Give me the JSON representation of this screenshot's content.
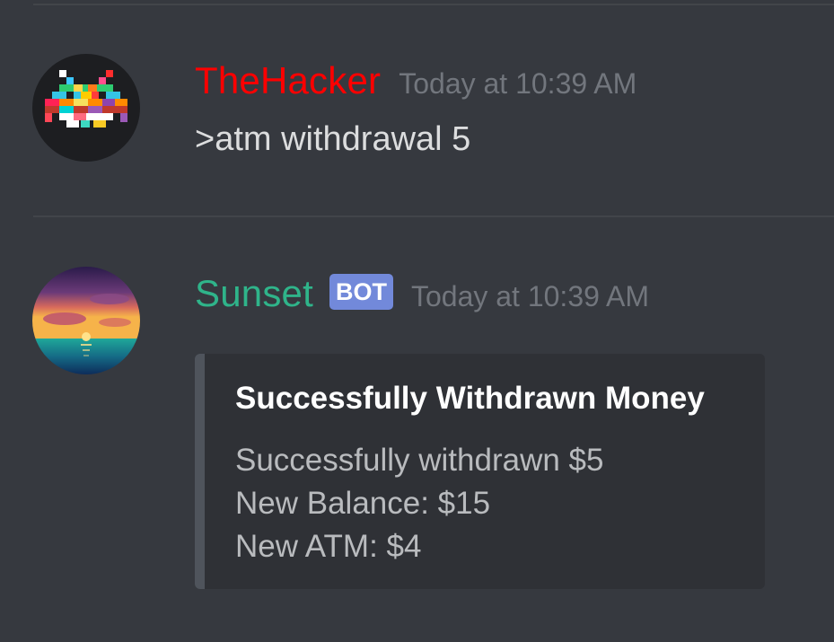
{
  "messages": [
    {
      "author": "TheHacker",
      "author_color": "#ff0000",
      "timestamp": "Today at 10:39 AM",
      "content": ">atm withdrawal 5",
      "avatar_icon": "space-invader-avatar"
    },
    {
      "author": "Sunset",
      "author_color": "#2fb48a",
      "badge": "BOT",
      "timestamp": "Today at 10:39 AM",
      "avatar_icon": "sunset-avatar",
      "embed": {
        "title": "Successfully Withdrawn Money",
        "lines": [
          "Successfully withdrawn $5",
          "New Balance: $15",
          "New ATM: $4"
        ],
        "border_color": "#4f545c"
      }
    }
  ],
  "colors": {
    "background": "#36393f",
    "embed_background": "#2f3136",
    "timestamp": "#72767d",
    "bot_badge": "#7289da"
  }
}
